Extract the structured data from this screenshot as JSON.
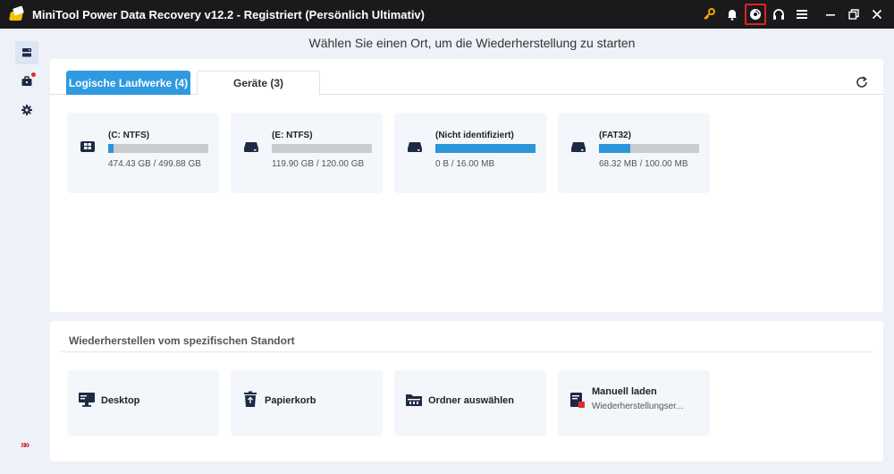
{
  "window": {
    "title": "MiniTool Power Data Recovery v12.2 - Registriert (Persönlich Ultimativ)",
    "icons": [
      "key-icon",
      "bell-icon",
      "disc-icon",
      "headset-icon",
      "menu-icon",
      "minimize-icon",
      "restore-icon",
      "close-icon"
    ]
  },
  "rail": {
    "items": [
      "drives-icon",
      "toolbox-icon",
      "settings-icon"
    ],
    "expand_label": "»»"
  },
  "heading": "Wählen Sie einen Ort, um die Wiederherstellung zu starten",
  "tabs": [
    {
      "label": "Logische Laufwerke (4)",
      "active": true
    },
    {
      "label": "Geräte (3)",
      "active": false
    }
  ],
  "drives": [
    {
      "name": "(C: NTFS)",
      "size": "474.43 GB / 499.88 GB",
      "used_fraction": 0.05,
      "icon": "windows-drive-icon"
    },
    {
      "name": "(E: NTFS)",
      "size": "119.90 GB / 120.00 GB",
      "used_fraction": 0.0,
      "icon": "drive-icon"
    },
    {
      "name": "(Nicht identifiziert)",
      "size": "0 B / 16.00 MB",
      "used_fraction": 1.0,
      "icon": "drive-icon"
    },
    {
      "name": "(FAT32)",
      "size": "68.32 MB / 100.00 MB",
      "used_fraction": 0.31,
      "icon": "drive-icon"
    }
  ],
  "locations": {
    "title": "Wiederherstellen vom spezifischen Standort",
    "items": [
      {
        "label": "Desktop",
        "sub": "",
        "icon": "desktop-icon"
      },
      {
        "label": "Papierkorb",
        "sub": "",
        "icon": "recycle-bin-icon"
      },
      {
        "label": "Ordner auswählen",
        "sub": "",
        "icon": "folder-icon"
      },
      {
        "label": "Manuell laden",
        "sub": "Wiederherstellungser...",
        "icon": "load-file-icon"
      }
    ]
  },
  "colors": {
    "accent": "#2f9ae0",
    "bar_fill": "#2a96d9",
    "highlight": "#e32020"
  }
}
